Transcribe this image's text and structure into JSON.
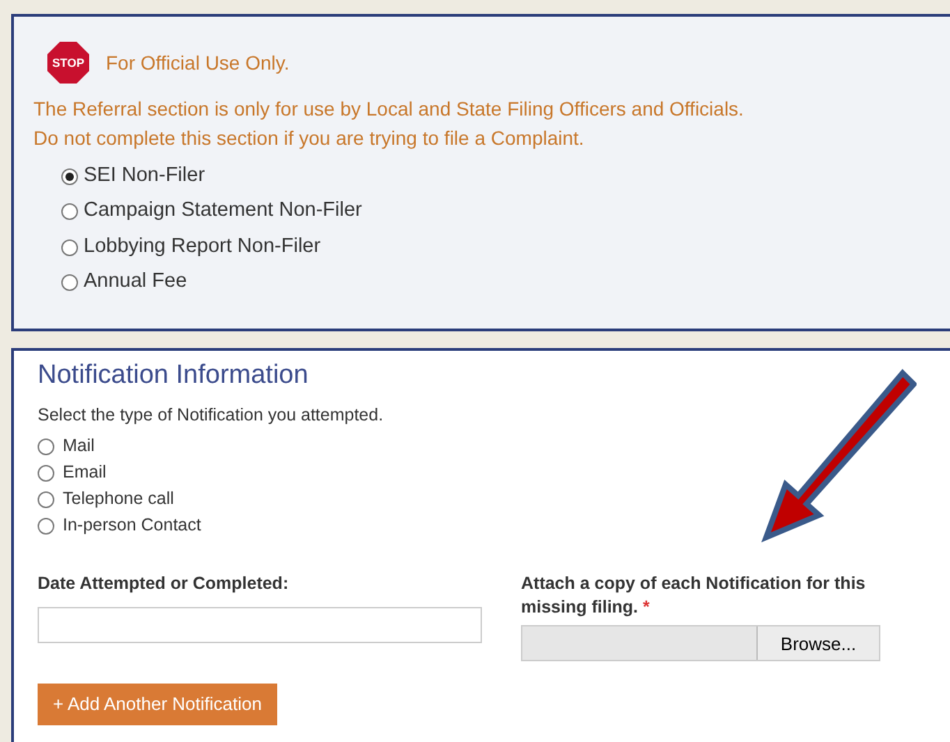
{
  "referral": {
    "stop_sign": "STOP",
    "notice_title": "For Official Use Only.",
    "notice_lines": [
      "The Referral section is only for use by Local and State Filing Officers and Officials.",
      "Do not complete this section if you are trying to file a Complaint."
    ],
    "options": [
      {
        "label": "SEI Non-Filer",
        "selected": true
      },
      {
        "label": "Campaign Statement Non-Filer",
        "selected": false
      },
      {
        "label": "Lobbying Report Non-Filer",
        "selected": false
      },
      {
        "label": "Annual Fee",
        "selected": false
      }
    ]
  },
  "notification": {
    "title": "Notification Information",
    "prompt": "Select the type of Notification you attempted.",
    "options": [
      {
        "label": "Mail",
        "selected": false
      },
      {
        "label": "Email",
        "selected": false
      },
      {
        "label": "Telephone call",
        "selected": false
      },
      {
        "label": "In-person Contact",
        "selected": false
      }
    ],
    "date_label": "Date Attempted or Completed:",
    "attach_label": "Attach a copy of each Notification for this missing filing.",
    "required_mark": "*",
    "browse_button": "Browse...",
    "add_button": "+ Add Another Notification"
  }
}
